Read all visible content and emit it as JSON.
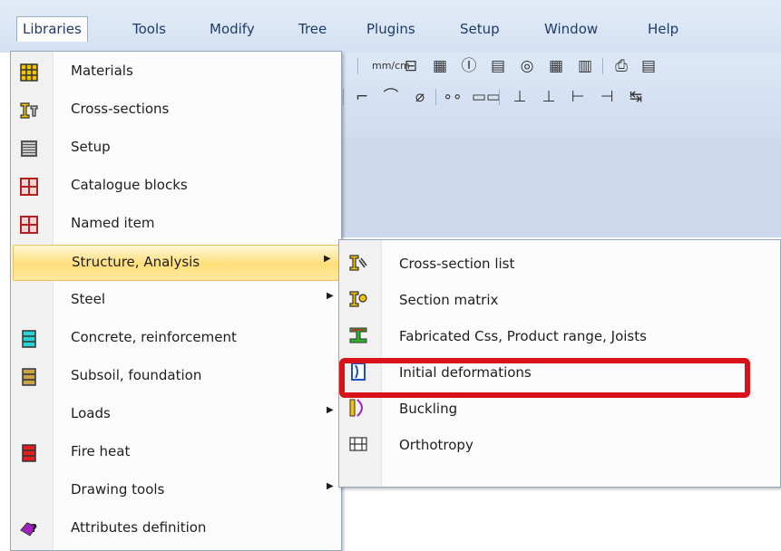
{
  "menubar": {
    "items": [
      {
        "label": "Libraries",
        "active": true
      },
      {
        "label": "Tools"
      },
      {
        "label": "Modify"
      },
      {
        "label": "Tree"
      },
      {
        "label": "Plugins"
      },
      {
        "label": "Setup"
      },
      {
        "label": "Window"
      },
      {
        "label": "Help"
      }
    ]
  },
  "toolbar": {
    "row1_glyphs": [
      "mm/cm",
      "⊟",
      "▦",
      "Ⓘ",
      "▤",
      "◎",
      "▦",
      "▥",
      "⎙",
      "▤"
    ],
    "row2_glyphs": [
      "⌐",
      "⌒",
      "⌀",
      "∘∘",
      "▭▭",
      "⊥",
      "⊥",
      "⊢",
      "⊣",
      "↹"
    ]
  },
  "main_menu": {
    "items": [
      {
        "label": "Materials",
        "icon": "materials-icon",
        "submenu": false
      },
      {
        "label": "Cross-sections",
        "icon": "cross-section-icon",
        "submenu": false
      },
      {
        "label": "Setup",
        "icon": "setup-icon",
        "submenu": false
      },
      {
        "label": "Catalogue blocks",
        "icon": "catalogue-block-icon",
        "submenu": false
      },
      {
        "label": "Named item",
        "icon": "named-item-icon",
        "submenu": false
      },
      {
        "label": "Structure, Analysis",
        "icon": "",
        "submenu": true,
        "highlighted": true
      },
      {
        "label": "Steel",
        "icon": "",
        "submenu": true
      },
      {
        "label": "Concrete, reinforcement",
        "icon": "concrete-icon",
        "submenu": false
      },
      {
        "label": "Subsoil, foundation",
        "icon": "subsoil-icon",
        "submenu": false
      },
      {
        "label": "Loads",
        "icon": "",
        "submenu": true
      },
      {
        "label": "Fire heat",
        "icon": "fire-heat-icon",
        "submenu": false
      },
      {
        "label": "Drawing tools",
        "icon": "",
        "submenu": true
      },
      {
        "label": "Attributes definition",
        "icon": "attributes-icon",
        "submenu": false
      }
    ]
  },
  "sub_menu": {
    "items": [
      {
        "label": "Cross-section list",
        "icon": "cross-section-list-icon"
      },
      {
        "label": "Section matrix",
        "icon": "section-matrix-icon"
      },
      {
        "label": "Fabricated Css, Product range, Joists",
        "icon": "fabricated-css-icon"
      },
      {
        "label": "Initial deformations",
        "icon": "initial-deformations-icon",
        "callout": true
      },
      {
        "label": "Buckling",
        "icon": "buckling-icon"
      },
      {
        "label": "Orthotropy",
        "icon": "orthotropy-icon"
      }
    ]
  },
  "colors": {
    "callout": "#d8121b",
    "highlight": "#ffdf7a",
    "menubar_text": "#1f3b66"
  }
}
